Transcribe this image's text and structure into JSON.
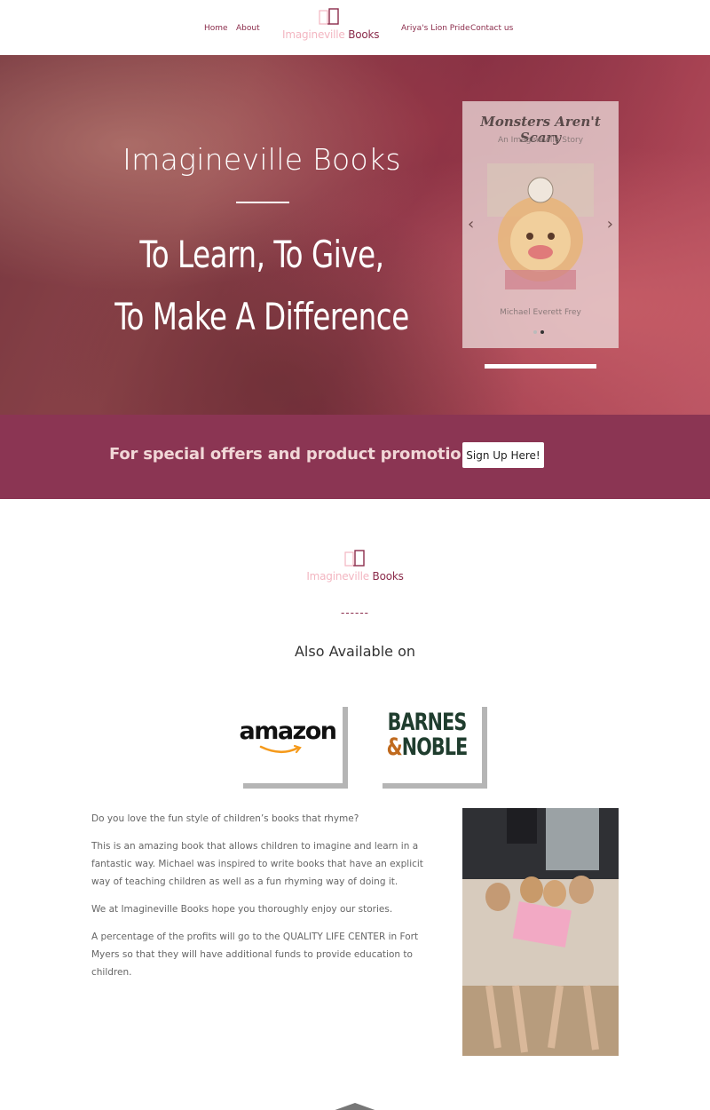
{
  "nav": {
    "home": "Home",
    "about": "About",
    "lion_pride": "Ariya's Lion Pride",
    "contact": "Contact us",
    "logo_light": "Imagineville",
    "logo_dark": "Books"
  },
  "hero": {
    "title": "Imagineville Books",
    "line1": "To Learn, To Give,",
    "line2": "To Make A Difference",
    "slide": {
      "book_title": "Monsters Aren't Scary",
      "book_subtitle": "An Imagineville Story",
      "author": "Michael Everett Frey",
      "arrow_left": "‹",
      "arrow_right": "›"
    }
  },
  "promo": {
    "text": "For special offers and product promotions",
    "button": "Sign Up Here!"
  },
  "middle": {
    "logo_light": "Imagineville",
    "logo_dark": "Books",
    "dashes": "------",
    "also_available": "Also Available on",
    "amazon": "amazon",
    "bn_line1": "BARNES",
    "bn_amp": "&",
    "bn_line2": "NOBLE"
  },
  "copy": {
    "p1": "Do you love the fun style of children’s books that rhyme?",
    "p2": "This is an amazing book that allows children to imagine and learn in a fantastic way. Michael was inspired to write books that have an explicit way of teaching children as well as a fun rhyming way of doing it.",
    "p3": "We at Imagineville Books hope you thoroughly enjoy our stories.",
    "p4": "A percentage of the profits will go to the QUALITY LIFE CENTER in Fort Myers so that they will have additional funds to provide education to children."
  },
  "colors": {
    "brand": "#8b2c4b",
    "promo_bg": "#8b3553",
    "logo_pink": "#f3b6c1"
  },
  "icons": {
    "logo": "open-book-icon",
    "slider_prev": "chevron-left-icon",
    "slider_next": "chevron-right-icon"
  }
}
